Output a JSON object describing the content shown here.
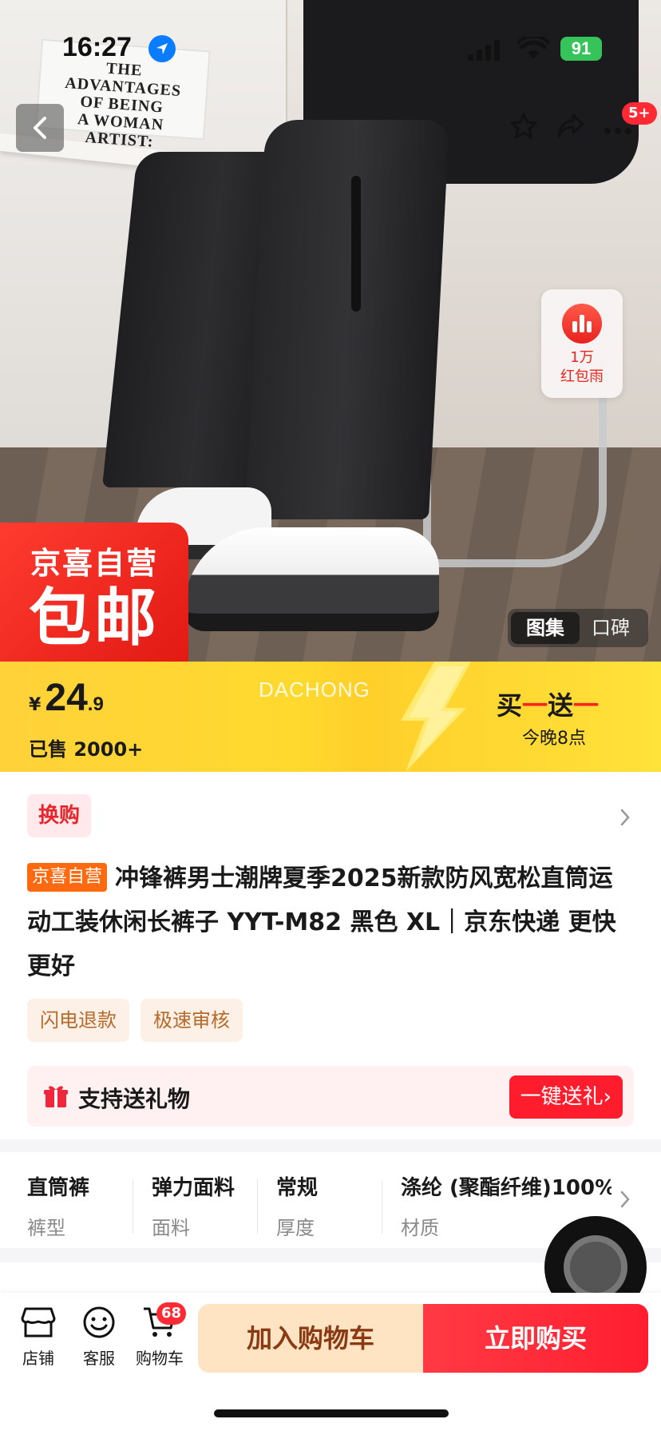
{
  "status_bar": {
    "time": "16:27",
    "battery": "91"
  },
  "hero": {
    "poster_lines": [
      "THE ADVANTAGES",
      "OF BEING",
      "A WOMAN ARTIST:"
    ],
    "more_badge": "5+",
    "redpacket": {
      "line1": "1万",
      "line2": "红包雨"
    },
    "jx_badge": {
      "top": "京喜自营",
      "big": "包邮"
    },
    "gallery_tabs": {
      "active": "图集",
      "other": "口碑"
    }
  },
  "price_banner": {
    "currency": "¥",
    "price_int": "24",
    "price_dec": ".9",
    "sold": "已售 2000+",
    "brand_watermark": "DACHONG",
    "promo": {
      "part1": "买",
      "dash1": "一",
      "part2": "送",
      "dash2": "一",
      "subtitle": "今晚8点"
    }
  },
  "product": {
    "swap_tag": "换购",
    "title_badge": "京喜自营",
    "title": "冲锋裤男士潮牌夏季2025新款防风宽松直筒运动工装休闲长裤子 YYT-M82 黑色 XL｜京东快递 更快更好",
    "service_tags": [
      "闪电退款",
      "极速审核"
    ],
    "gift": {
      "label": "支持送礼物",
      "button": "一键送礼›"
    }
  },
  "attributes": [
    {
      "value": "直筒裤",
      "label": "裤型"
    },
    {
      "value": "弹力面料",
      "label": "面料"
    },
    {
      "value": "常规",
      "label": "厚度"
    },
    {
      "value": "涤纶 (聚酯纤维)100%",
      "label": "材质"
    }
  ],
  "bottom_bar": {
    "store": "店铺",
    "service": "客服",
    "cart": "购物车",
    "cart_count": "68",
    "add_to_cart": "加入购物车",
    "buy_now": "立即购买"
  },
  "colors": {
    "accent_red": "#ff1e30",
    "banner_yellow": "#ffd23a",
    "jx_red": "#e11a14"
  }
}
